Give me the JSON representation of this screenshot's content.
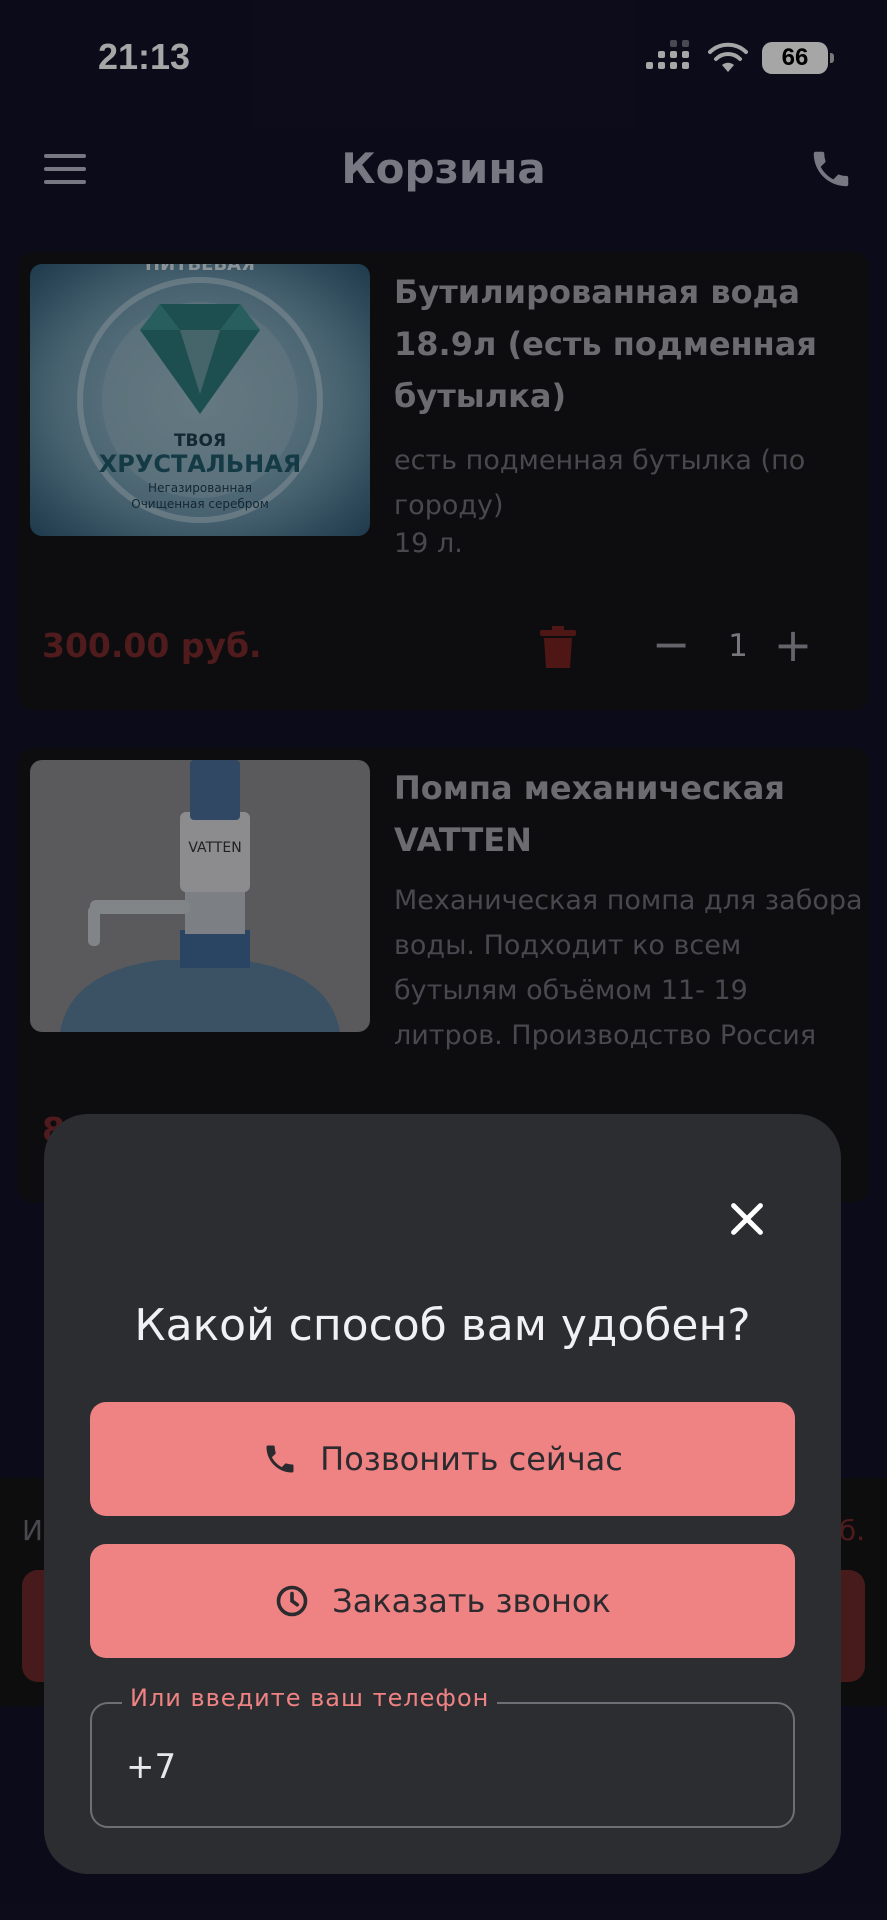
{
  "status_bar": {
    "time": "21:13",
    "battery": "66"
  },
  "header": {
    "title": "Корзина",
    "menu_icon": "menu-icon",
    "phone_icon": "phone-icon"
  },
  "cart": {
    "items": [
      {
        "name": "Бутилированная вода 18.9л (есть подменная бутылка)",
        "description": "есть подменная бутылка (по городу)",
        "volume": "19 л.",
        "price": "300.00 руб.",
        "quantity": "1",
        "image_text": {
          "top": "ПИТЬЕВАЯ",
          "brand_line1": "ТВОЯ",
          "brand_line2": "ХРУСТАЛЬНАЯ",
          "sub1": "Негазированная",
          "sub2": "Очищенная серебром"
        }
      },
      {
        "name": "Помпа механическая VATTEN",
        "description": "Механическая помпа для забора воды. Подходит ко всем бутылям объёмом 11- 19 литров. Производство Россия",
        "price": "8",
        "image_text": {
          "brand": "VATTEN"
        }
      }
    ]
  },
  "summary": {
    "label": "И",
    "total": "б."
  },
  "modal": {
    "title": "Какой способ вам удобен?",
    "call_now_label": "Позвонить сейчас",
    "order_call_label": "Заказать звонок",
    "phone_field_label": "Или введите ваш телефон",
    "phone_value": "+7"
  },
  "colors": {
    "accent": "#ef8282",
    "price": "#7a2a2c",
    "modal_bg": "#2c2d31",
    "page_bg": "#121229"
  }
}
